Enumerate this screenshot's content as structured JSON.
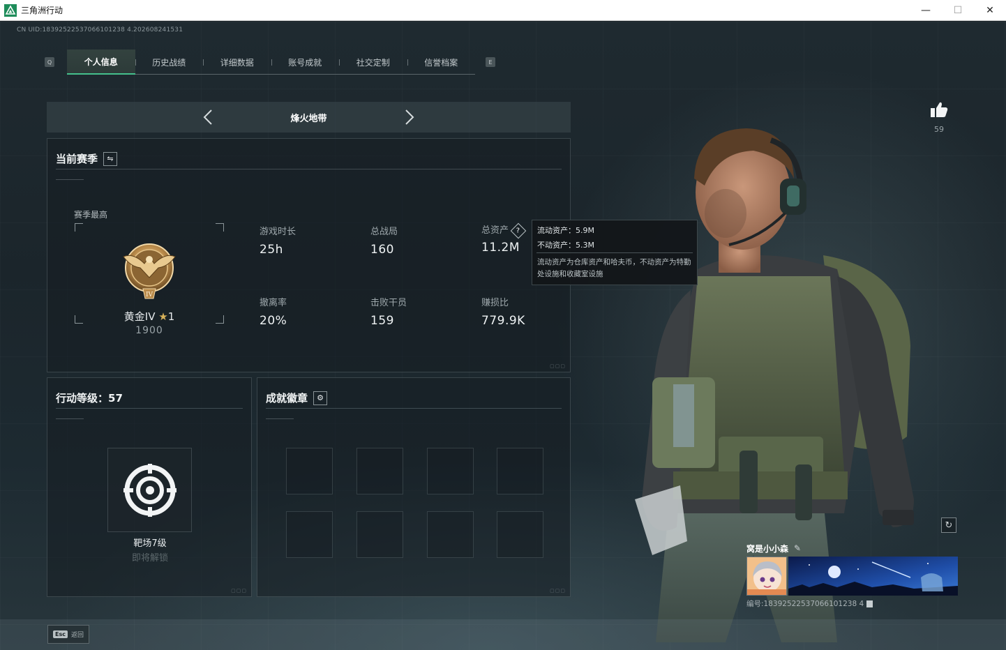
{
  "window": {
    "title": "三角洲行动",
    "minimize": "—",
    "maximize": "☐",
    "close": "✕"
  },
  "uid_line": "CN UID:18392522537066101238 4.202608241531",
  "tabs": {
    "left_key": "Q",
    "right_key": "E",
    "items": [
      {
        "label": "个人信息",
        "active": true
      },
      {
        "label": "历史战绩",
        "active": false
      },
      {
        "label": "详细数据",
        "active": false
      },
      {
        "label": "账号成就",
        "active": false
      },
      {
        "label": "社交定制",
        "active": false
      },
      {
        "label": "信誉档案",
        "active": false
      }
    ]
  },
  "mode": {
    "title": "烽火地带"
  },
  "season": {
    "title": "当前赛季",
    "swap_icon": "⇋",
    "best_label": "赛季最高",
    "rank_name": "黄金IV",
    "rank_stars": "1",
    "rank_score": "1900",
    "stats": {
      "play_time_label": "游戏时长",
      "play_time": "25h",
      "matches_label": "总战局",
      "matches": "160",
      "assets_label": "总资产",
      "assets": "11.2M",
      "extract_rate_label": "撤离率",
      "extract_rate": "20%",
      "kills_label": "击败干员",
      "kills": "159",
      "profit_ratio_label": "赚损比",
      "profit_ratio": "779.9K"
    }
  },
  "tooltip": {
    "liquid": "流动资产：5.9M",
    "fixed": "不动资产：5.3M",
    "note": "流动资产为仓库资产和哈夫币，不动资产为特勤处设施和收藏室设施"
  },
  "level": {
    "title": "行动等级：57",
    "item_name": "靶场7级",
    "item_status": "即将解锁"
  },
  "achievements": {
    "title": "成就徽章",
    "settings_icon": "⚙"
  },
  "likes": {
    "count": "59"
  },
  "card": {
    "name": "窝是小小森",
    "id": "编号:18392522537066101238 4"
  },
  "footer": {
    "esc_key": "Esc",
    "esc_label": "返回"
  },
  "colors": {
    "accent": "#44c08c",
    "gold": "#c79a52"
  }
}
